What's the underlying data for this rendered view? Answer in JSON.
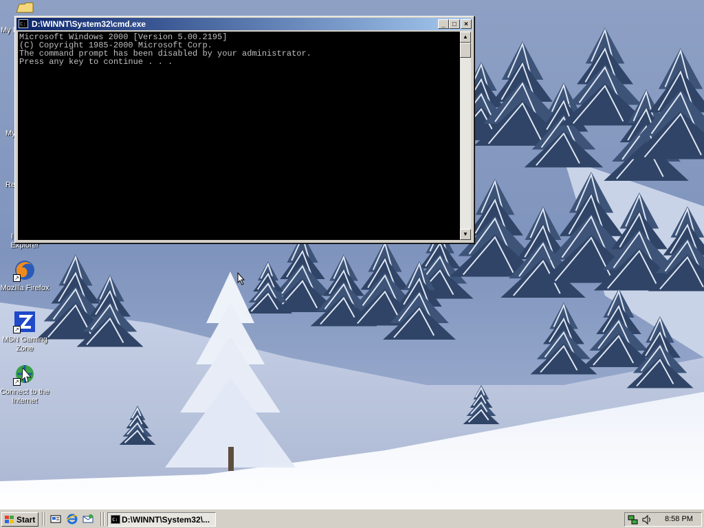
{
  "window": {
    "title": "D:\\WINNT\\System32\\cmd.exe",
    "min_label": "_",
    "max_label": "□",
    "close_label": "×",
    "console_lines": [
      "Microsoft Windows 2000 [Version 5.00.2195]",
      "(C) Copyright 1985-2000 Microsoft Corp.",
      "",
      "The command prompt has been disabled by your administrator.",
      "",
      "Press any key to continue . . ."
    ]
  },
  "desktop": {
    "clipped_labels": [
      "My D",
      "My",
      "Re",
      "I"
    ],
    "icons": [
      {
        "label": "Explorer",
        "icon": "internet-explorer-icon"
      },
      {
        "label": "Mozilla Firefox",
        "icon": "firefox-icon"
      },
      {
        "label": "MSN Gaming Zone",
        "icon": "msn-gaming-zone-icon"
      },
      {
        "label": "Connect to the Internet",
        "icon": "connect-internet-icon"
      }
    ]
  },
  "taskbar": {
    "start_label": "Start",
    "task_label": "D:\\WINNT\\System32\\...",
    "clock": "8:58 PM",
    "quick_launch": [
      "show-desktop-icon",
      "internet-explorer-icon",
      "outlook-express-icon"
    ],
    "tray_icons": [
      "network-icon",
      "volume-icon"
    ]
  },
  "colors": {
    "title_start": "#0a246a",
    "title_end": "#a6caf0",
    "face": "#d4d0c8",
    "console_bg": "#000000",
    "console_text": "#c0c0c0"
  }
}
